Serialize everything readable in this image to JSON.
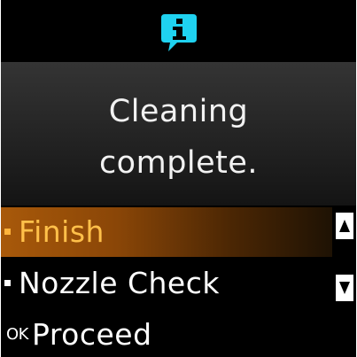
{
  "header": {
    "icon": "info-icon",
    "icon_color": "#1fd2f0"
  },
  "message": {
    "line1": "Cleaning",
    "line2": "complete."
  },
  "menu": {
    "items": [
      {
        "label": "Finish",
        "selected": true
      },
      {
        "label": "Nozzle Check",
        "selected": false
      }
    ],
    "selected_color": "#c26a10",
    "selected_text_color": "#ffc04a"
  },
  "scroll": {
    "up_icon": "arrow-up-icon",
    "down_icon": "arrow-down-icon"
  },
  "footer": {
    "ok_label": "OK",
    "action_label": "Proceed"
  }
}
